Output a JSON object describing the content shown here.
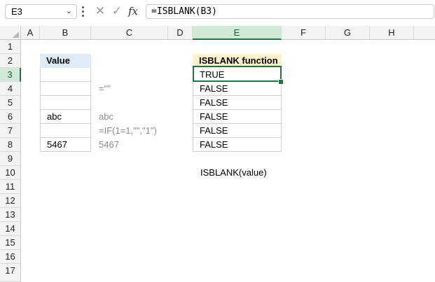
{
  "namebox": {
    "value": "E3",
    "dropdown_icon": "chevron-down-icon"
  },
  "formula_bar": {
    "cancel_icon": "cancel-icon",
    "enter_icon": "check-icon",
    "fx_label": "fx",
    "formula": "=ISBLANK(B3)"
  },
  "columns": [
    "A",
    "B",
    "C",
    "D",
    "E",
    "F",
    "G",
    "H"
  ],
  "selected_column": "E",
  "rows": [
    "1",
    "2",
    "3",
    "4",
    "5",
    "6",
    "7",
    "8",
    "9",
    "10",
    "11",
    "12",
    "13",
    "14",
    "15",
    "16",
    "17"
  ],
  "selected_row": "3",
  "cells": {
    "B2": "Value",
    "B3": "",
    "B4": "",
    "B5": "",
    "B6": "abc",
    "B7": "",
    "B8": "5467",
    "C4": "=\"\"",
    "C6": "abc",
    "C7": "=IF(1=1,\"\",\"1\")",
    "C8": "5467",
    "E2": "ISBLANK function",
    "E3": "TRUE",
    "E4": "FALSE",
    "E5": "FALSE",
    "E6": "FALSE",
    "E7": "FALSE",
    "E8": "FALSE",
    "E10": "ISBLANK(value)"
  },
  "colors": {
    "accent": "#217346",
    "header_blue": "#ddebf7",
    "header_yellow": "#fff2cc",
    "muted_text": "#8c8c8c"
  }
}
